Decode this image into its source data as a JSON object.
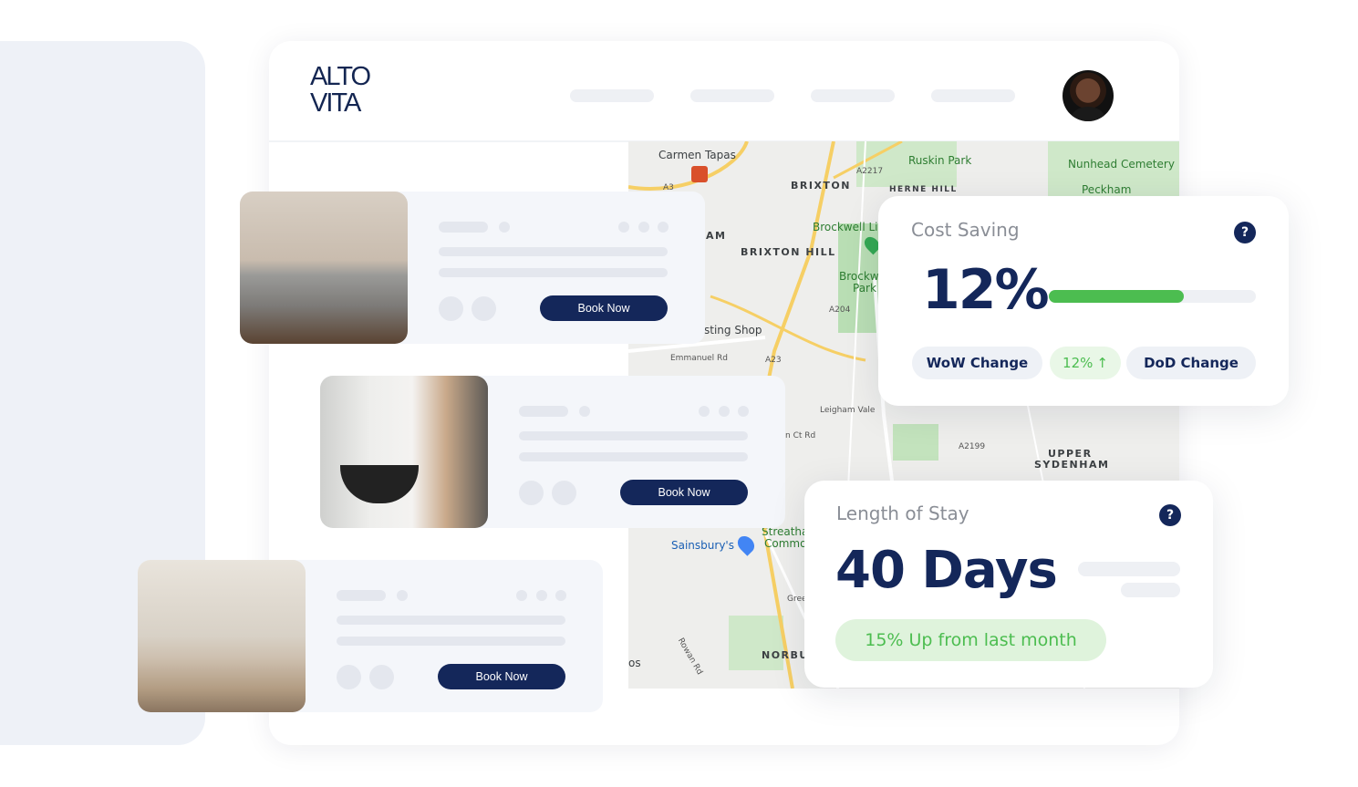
{
  "brand": {
    "logo_text_line1": "ALTO",
    "logo_text_line2": "VITA"
  },
  "map": {
    "labels": [
      "Carmen Tapas",
      "BRIXTON",
      "Ruskin Park",
      "Nunhead Cemetery",
      "Peckham",
      "HERNE HILL",
      "AM",
      "BRIXTON HILL",
      "Brockwell Li",
      "Brockw",
      "Park",
      "sting Shop",
      "Emmanuel Rd",
      "A23",
      "A204",
      "A2217",
      "A3",
      "Leigham Vale",
      "n Ct Rd",
      "A2199",
      "UPPER",
      "SYDENHAM",
      "Sainsbury's",
      "Streatha",
      "Commo",
      "Gree",
      "NORBUI",
      "Rowan Rd",
      "os"
    ]
  },
  "listings": [
    {
      "button": "Book Now"
    },
    {
      "button": "Book Now"
    },
    {
      "button": "Book Now"
    }
  ],
  "cost_saving": {
    "title": "Cost Saving",
    "value": "12%",
    "progress_percent": 65,
    "help": "?",
    "wow_label": "WoW Change",
    "change_value": "12%",
    "change_icon": "arrow-up",
    "dod_label": "DoD Change"
  },
  "length_of_stay": {
    "title": "Length of Stay",
    "value": "40 Days",
    "help": "?",
    "trend": "15% Up from last month"
  },
  "colors": {
    "navy": "#14275a",
    "green": "#4cbd50",
    "green_bg": "#dff3dc",
    "panel": "#eef1f7"
  }
}
